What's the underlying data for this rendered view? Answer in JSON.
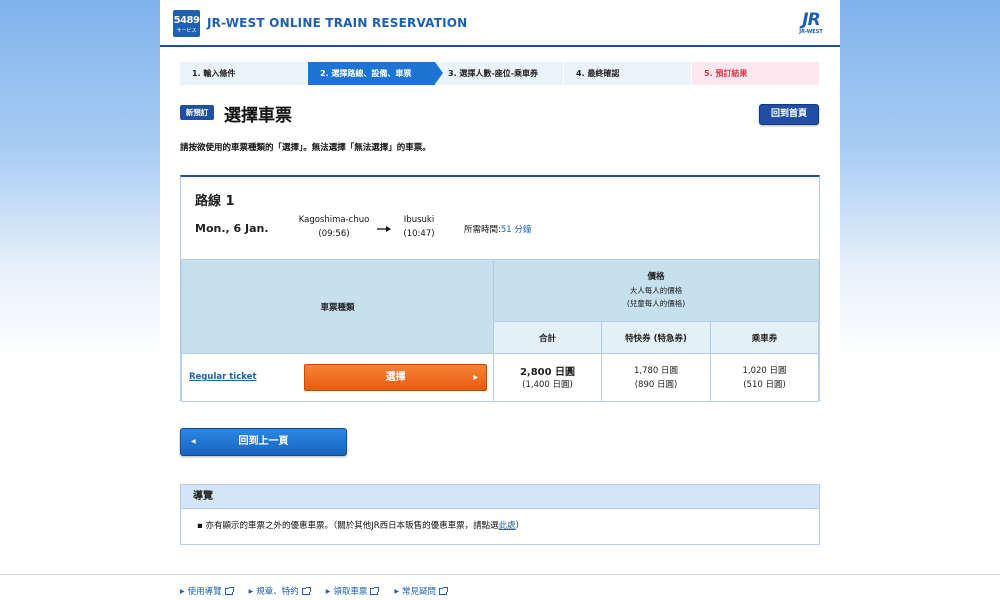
{
  "header": {
    "logo_number": "5489",
    "logo_sub": "サービス",
    "site_title": "JR-WEST ONLINE TRAIN RESERVATION",
    "brand_mark": "JR",
    "brand_sub": "JR-WEST"
  },
  "steps": [
    {
      "label": "1.  輸入條件",
      "state": "normal"
    },
    {
      "label": "2.  選擇路線、設備、車票",
      "state": "active"
    },
    {
      "label": "3.  選擇人數-座位-乘車券",
      "state": "normal"
    },
    {
      "label": "4.  最終確認",
      "state": "normal"
    },
    {
      "label": "5.  預訂結果",
      "state": "done"
    }
  ],
  "title": {
    "badge": "新預訂",
    "heading": "選擇車票",
    "home_button": "回到首頁"
  },
  "instruction": "請按欲使用的車票種類的「選擇」。無法選擇「無法選擇」的車票。",
  "route": {
    "title": "路線 1",
    "date": "Mon., 6 Jan.",
    "from_station": "Kagoshima-chuo",
    "from_time": "(09:56)",
    "to_station": "Ibusuki",
    "to_time": "(10:47)",
    "duration_label": "所需時間:",
    "duration_value": "51 分鐘"
  },
  "fare_table": {
    "col_type": "車票種類",
    "col_price": "價格",
    "col_price_adult": "大人每人的價格",
    "col_price_child": "(兒童每人的價格)",
    "col_total": "合計",
    "col_express": "特快券 (特急券)",
    "col_basic": "乘車券",
    "rows": [
      {
        "ticket": "Regular ticket",
        "select_label": "選擇",
        "total_adult": "2,800 日圓",
        "total_child": "(1,400 日圓)",
        "express_adult": "1,780 日圓",
        "express_child": "(890 日圓)",
        "basic_adult": "1,020 日圓",
        "basic_child": "(510 日圓)"
      }
    ]
  },
  "back_button": "回到上一頁",
  "guide": {
    "heading": "導覽",
    "item_text": "亦有顯示的車票之外的優惠車票。（關於其他JR西日本販售的優惠車票，請點選",
    "item_link": "此處",
    "item_end": "）"
  },
  "footer": {
    "links": [
      "使用導覽",
      "規章、特約",
      "領取車票",
      "常見疑問"
    ]
  },
  "colors": {
    "brand_blue": "#1f4ea2",
    "step_active": "#1e74d2",
    "select_orange": "#ee6a1c"
  }
}
